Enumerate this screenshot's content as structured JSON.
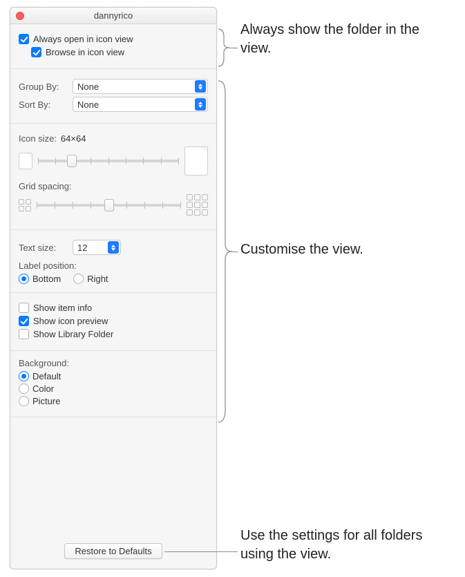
{
  "window": {
    "title": "dannyrico"
  },
  "view_opts": {
    "always_open_label": "Always open in icon view",
    "always_open_checked": true,
    "browse_label": "Browse in icon view",
    "browse_checked": true
  },
  "arrange": {
    "group_by_label": "Group By:",
    "group_by_value": "None",
    "sort_by_label": "Sort By:",
    "sort_by_value": "None"
  },
  "icon": {
    "size_label": "Icon size:",
    "size_value": "64×64",
    "slider_pos_pct": 24,
    "spacing_label": "Grid spacing:",
    "spacing_pos_pct": 50
  },
  "text": {
    "size_label": "Text size:",
    "size_value": "12",
    "label_pos_label": "Label position:",
    "bottom_label": "Bottom",
    "right_label": "Right",
    "selected": "Bottom"
  },
  "show": {
    "item_info_label": "Show item info",
    "item_info_checked": false,
    "icon_preview_label": "Show icon preview",
    "icon_preview_checked": true,
    "library_label": "Show Library Folder",
    "library_checked": false
  },
  "background": {
    "heading": "Background:",
    "default_label": "Default",
    "color_label": "Color",
    "picture_label": "Picture",
    "selected": "Default"
  },
  "footer": {
    "restore_label": "Restore to Defaults"
  },
  "callouts": {
    "c1": "Always show the folder in the view.",
    "c2": "Customise the view.",
    "c3": "Use the settings for all folders using the view."
  }
}
